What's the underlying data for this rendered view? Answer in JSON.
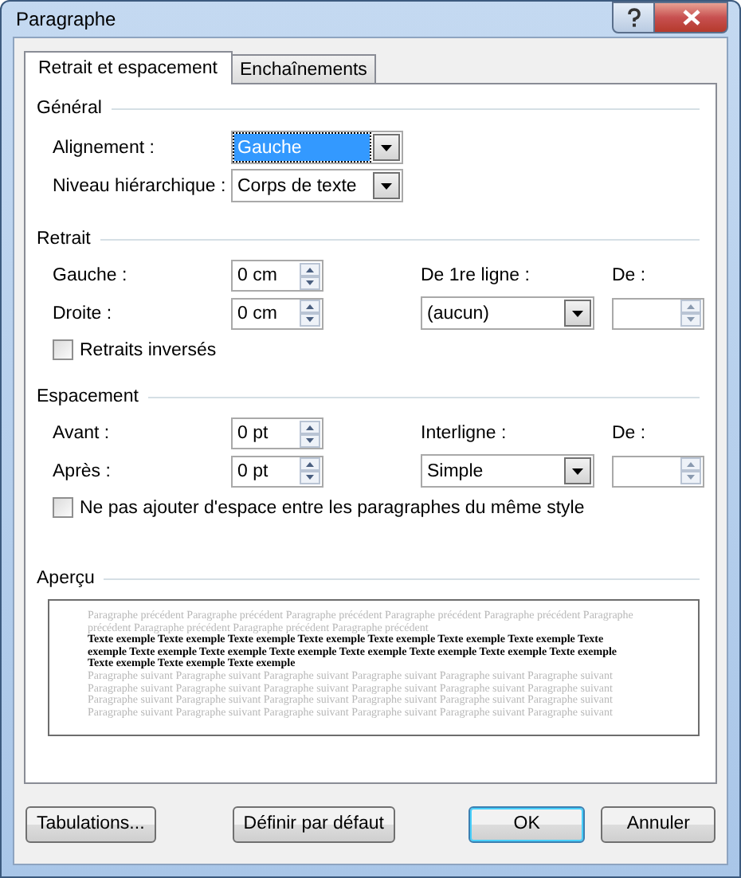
{
  "window": {
    "title": "Paragraphe"
  },
  "tabs": [
    {
      "label": "Retrait et espacement",
      "selected": true
    },
    {
      "label": "Enchaînements",
      "selected": false
    }
  ],
  "general": {
    "title": "Général",
    "fields": [
      {
        "label": "Alignement :",
        "value": "Gauche",
        "focused": true
      },
      {
        "label": "Niveau hiérarchique :",
        "value": "Corps de texte",
        "focused": false
      }
    ]
  },
  "retrait": {
    "title": "Retrait",
    "left_fields": [
      {
        "label": "Gauche :",
        "value": "0 cm"
      },
      {
        "label": "Droite :",
        "value": "0 cm"
      }
    ],
    "special_label": "De 1re ligne :",
    "special_value": "(aucun)",
    "by_label": "De :",
    "checkbox": {
      "label": "Retraits inversés",
      "checked": false
    }
  },
  "espacement": {
    "title": "Espacement",
    "left_fields": [
      {
        "label": "Avant :",
        "value": "0 pt"
      },
      {
        "label": "Après :",
        "value": "0 pt"
      }
    ],
    "special_label": "Interligne :",
    "special_value": "Simple",
    "by_label": "De :",
    "checkbox": {
      "label": "Ne pas ajouter d'espace entre les paragraphes du même style",
      "checked": false
    }
  },
  "apercu": {
    "title": "Aperçu",
    "paragraphs": [
      {
        "kind": "previous",
        "text": "Paragraphe précédent Paragraphe précédent Paragraphe précédent Paragraphe précédent Paragraphe précédent Paragraphe précédent Paragraphe précédent Paragraphe précédent Paragraphe précédent"
      },
      {
        "kind": "sample",
        "text": "Texte exemple Texte exemple Texte exemple Texte exemple Texte exemple Texte exemple Texte exemple Texte exemple Texte exemple Texte exemple Texte exemple Texte exemple Texte exemple Texte exemple Texte exemple Texte exemple Texte exemple Texte exemple"
      },
      {
        "kind": "following",
        "text": "Paragraphe suivant Paragraphe suivant Paragraphe suivant Paragraphe suivant Paragraphe suivant Paragraphe suivant Paragraphe suivant Paragraphe suivant Paragraphe suivant Paragraphe suivant Paragraphe suivant Paragraphe suivant Paragraphe suivant Paragraphe suivant Paragraphe suivant Paragraphe suivant Paragraphe suivant Paragraphe suivant Paragraphe suivant Paragraphe suivant Paragraphe suivant Paragraphe suivant Paragraphe suivant Paragraphe suivant"
      }
    ]
  },
  "buttons": [
    {
      "label": "Tabulations...",
      "kind": "normal"
    },
    {
      "label": "Définir par défaut",
      "kind": "normal"
    },
    {
      "label": "OK",
      "kind": "default"
    },
    {
      "label": "Annuler",
      "kind": "normal"
    }
  ]
}
